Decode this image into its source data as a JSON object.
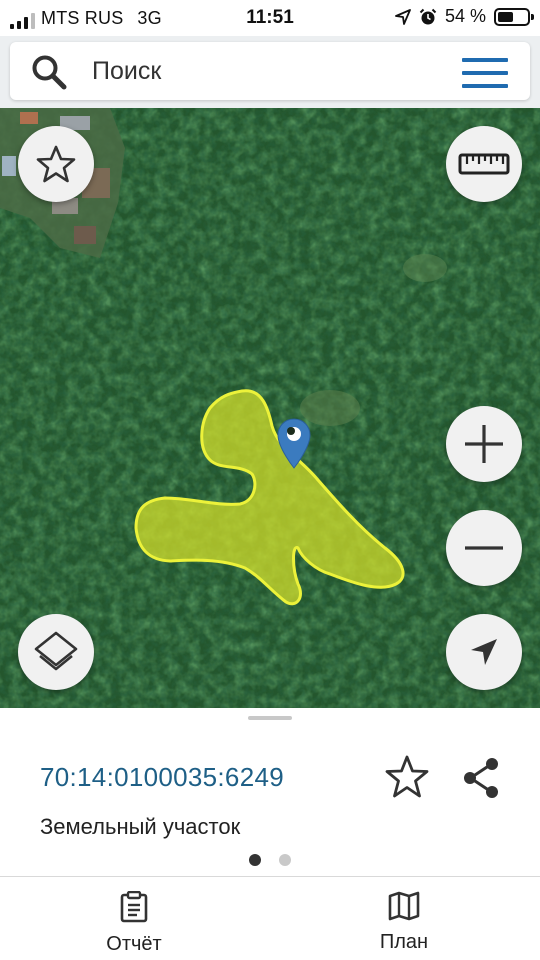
{
  "status_bar": {
    "carrier": "MTS RUS",
    "network": "3G",
    "time": "11:51",
    "battery_percent": "54 %",
    "battery_level": 0.54,
    "icons": [
      "signal-icon",
      "location-arrow-icon",
      "alarm-icon",
      "battery-icon"
    ]
  },
  "search": {
    "placeholder": "Поиск",
    "search_icon": "search-icon",
    "menu_icon": "hamburger-menu-icon"
  },
  "map": {
    "buttons": {
      "favorites": "star-icon",
      "ruler": "ruler-icon",
      "zoom_in": "plus-icon",
      "zoom_out": "minus-icon",
      "layers": "layers-icon",
      "locate": "location-arrow-icon"
    },
    "parcel_highlight_color": "#d7e22a",
    "marker_color": "#3b7bbf"
  },
  "parcel": {
    "cadastral_number": "70:14:0100035:6249",
    "type": "Земельный участок"
  },
  "pager": {
    "pages": 2,
    "active": 1
  },
  "tabs": [
    {
      "label": "Отчёт",
      "icon": "report-clipboard-icon"
    },
    {
      "label": "План",
      "icon": "map-plan-icon"
    }
  ],
  "colors": {
    "accent": "#1f6bb0",
    "cadastral_text": "#1e5f86"
  }
}
